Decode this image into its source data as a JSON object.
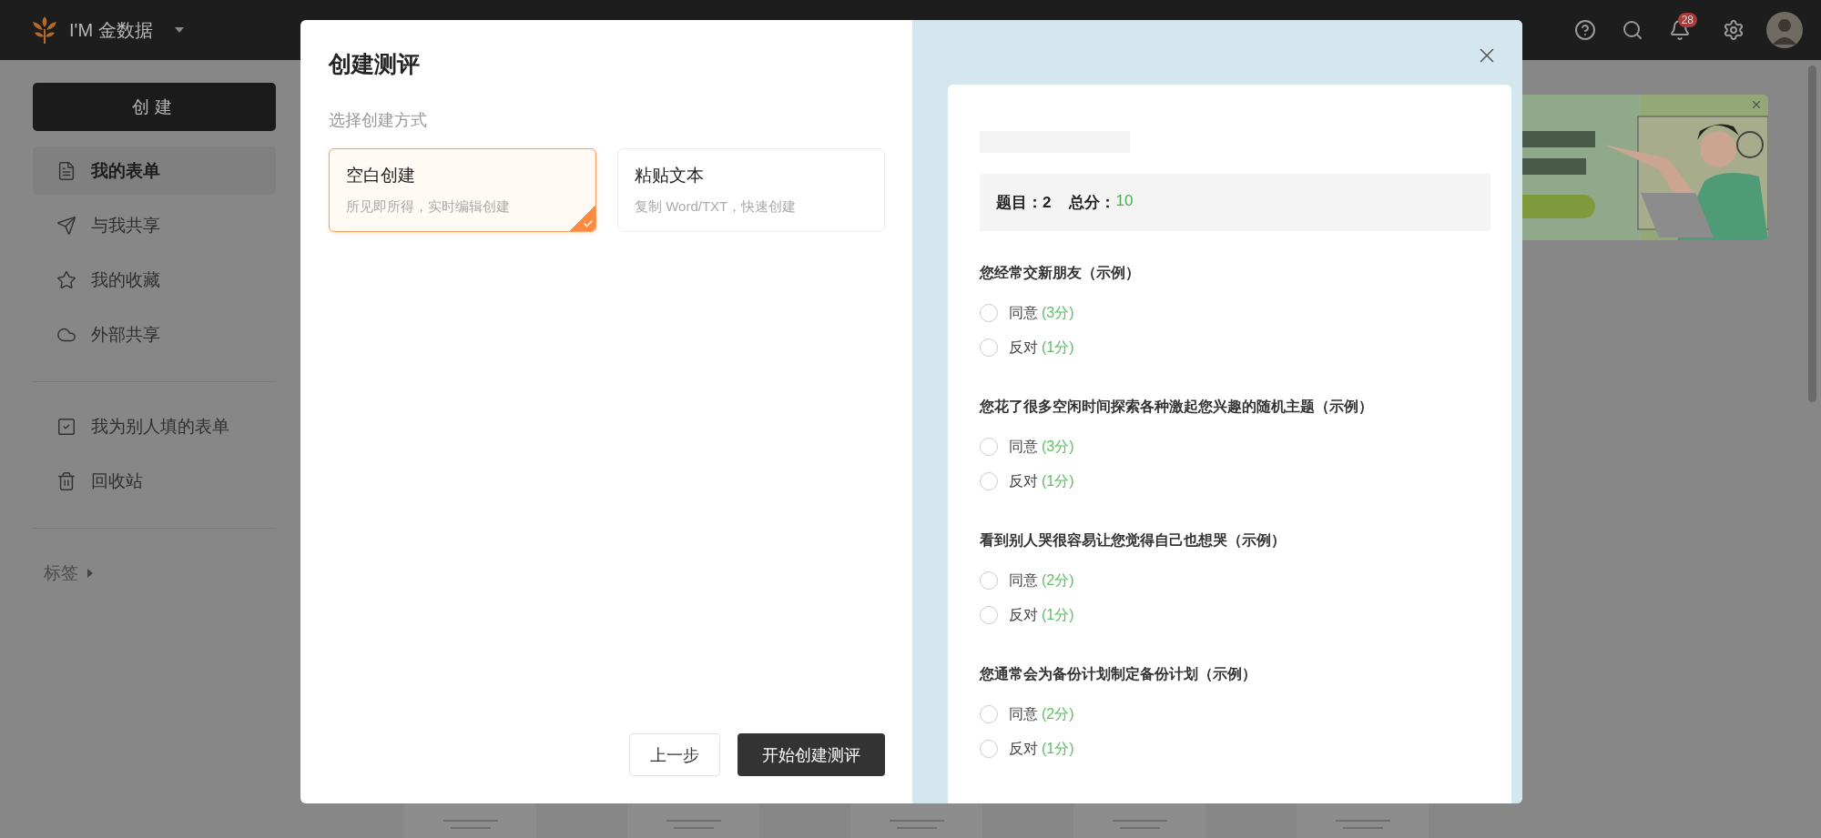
{
  "top_bar": {
    "brand": "I'M 金数据",
    "notification_count": "28"
  },
  "sidebar": {
    "create_button": "创建",
    "sections": [
      {
        "items": [
          {
            "label": "我的表单",
            "selected": true
          },
          {
            "label": "与我共享",
            "selected": false
          },
          {
            "label": "我的收藏",
            "selected": false
          },
          {
            "label": "外部共享",
            "selected": false
          }
        ]
      },
      {
        "items": [
          {
            "label": "我为别人填的表单",
            "selected": false
          },
          {
            "label": "回收站",
            "selected": false
          }
        ]
      }
    ],
    "tags_label": "标签"
  },
  "modal": {
    "title": "创建测评",
    "subtitle": "选择创建方式",
    "methods": [
      {
        "title": "空白创建",
        "description": "所见即所得，实时编辑创建",
        "selected": true
      },
      {
        "title": "粘贴文本",
        "description": "复制 Word/TXT，快速创建",
        "selected": false
      }
    ],
    "back_button": "上一步",
    "start_button": "开始创建测评",
    "preview": {
      "question_count": "题目：2",
      "score_label": "总分：",
      "score": "10",
      "questions": [
        {
          "title": "您经常交新朋友（示例）",
          "options": [
            {
              "label": "同意",
              "points": "(3分)",
              "selected": false
            },
            {
              "label": "反对",
              "points": "(1分)",
              "selected": false
            }
          ]
        },
        {
          "title": "您花了很多空闲时间探索各种激起您兴趣的随机主题（示例）",
          "options": [
            {
              "label": "同意",
              "points": "(3分)",
              "selected": false
            },
            {
              "label": "反对",
              "points": "(1分)",
              "selected": false
            }
          ]
        },
        {
          "title": "看到别人哭很容易让您觉得自己也想哭（示例）",
          "options": [
            {
              "label": "同意",
              "points": "(2分)",
              "selected": false
            },
            {
              "label": "反对",
              "points": "(1分)",
              "selected": false
            }
          ]
        },
        {
          "title": "您通常会为备份计划制定备份计划（示例）",
          "options": [
            {
              "label": "同意",
              "points": "(2分)",
              "selected": false
            },
            {
              "label": "反对",
              "points": "(1分)",
              "selected": false
            }
          ]
        }
      ]
    }
  }
}
